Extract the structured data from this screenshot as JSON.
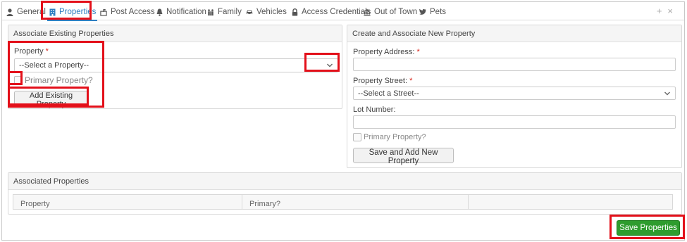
{
  "tabs": [
    {
      "label": "General",
      "icon": "person-icon"
    },
    {
      "label": "Properties",
      "icon": "building-icon",
      "active": true
    },
    {
      "label": "Post Access",
      "icon": "post-icon"
    },
    {
      "label": "Notification",
      "icon": "bell-icon"
    },
    {
      "label": "Family",
      "icon": "family-icon"
    },
    {
      "label": "Vehicles",
      "icon": "car-icon"
    },
    {
      "label": "Access Credentials",
      "icon": "lock-icon"
    },
    {
      "label": "Out of Town",
      "icon": "bank-icon"
    },
    {
      "label": "Pets",
      "icon": "bird-icon"
    }
  ],
  "tab_tools": {
    "add": "+",
    "close": "×"
  },
  "existing": {
    "title": "Associate Existing Properties",
    "property_label": "Property",
    "required_mark": "*",
    "select_value": "--Select a Property--",
    "primary_label": "Primary Property?",
    "add_button": "Add Existing Property"
  },
  "create": {
    "title": "Create and Associate New Property",
    "address_label": "Property Address:",
    "street_label": "Property Street:",
    "street_value": "--Select a Street--",
    "lot_label": "Lot Number:",
    "primary_label": "Primary Property?",
    "save_button": "Save and Add New Property"
  },
  "associated": {
    "title": "Associated Properties",
    "columns": [
      "Property",
      "Primary?",
      ""
    ]
  },
  "save_properties_button": "Save Properties",
  "colors": {
    "accent": "#2f7fc1",
    "highlight": "#e3101a",
    "save": "#2e9c2e"
  }
}
